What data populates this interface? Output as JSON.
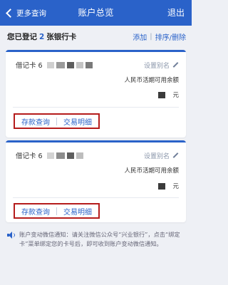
{
  "header": {
    "back_label": "更多查询",
    "title": "账户总览",
    "exit_label": "退出"
  },
  "summary": {
    "prefix": "您已登记",
    "count": "2",
    "suffix": "张银行卡",
    "add": "添加",
    "sort_delete": "排序/删除"
  },
  "cards": [
    {
      "type_label": "借记卡 6",
      "alias_label": "设置别名",
      "balance_label": "人民币活期可用余额",
      "currency_unit": "元",
      "links": {
        "deposit": "存款查询",
        "transactions": "交易明细"
      }
    },
    {
      "type_label": "借记卡 6",
      "alias_label": "设置别名",
      "balance_label": "人民币活期可用余额",
      "currency_unit": "元",
      "links": {
        "deposit": "存款查询",
        "transactions": "交易明细"
      }
    }
  ],
  "notice": {
    "text": "账户变动微信通知：请关注微信公众号“兴业银行”，点击“绑定卡”菜单绑定您的卡号后，即可收到账户变动微信通知。"
  },
  "colors": {
    "primary": "#2a62c9",
    "highlight_border": "#b51c1c"
  }
}
